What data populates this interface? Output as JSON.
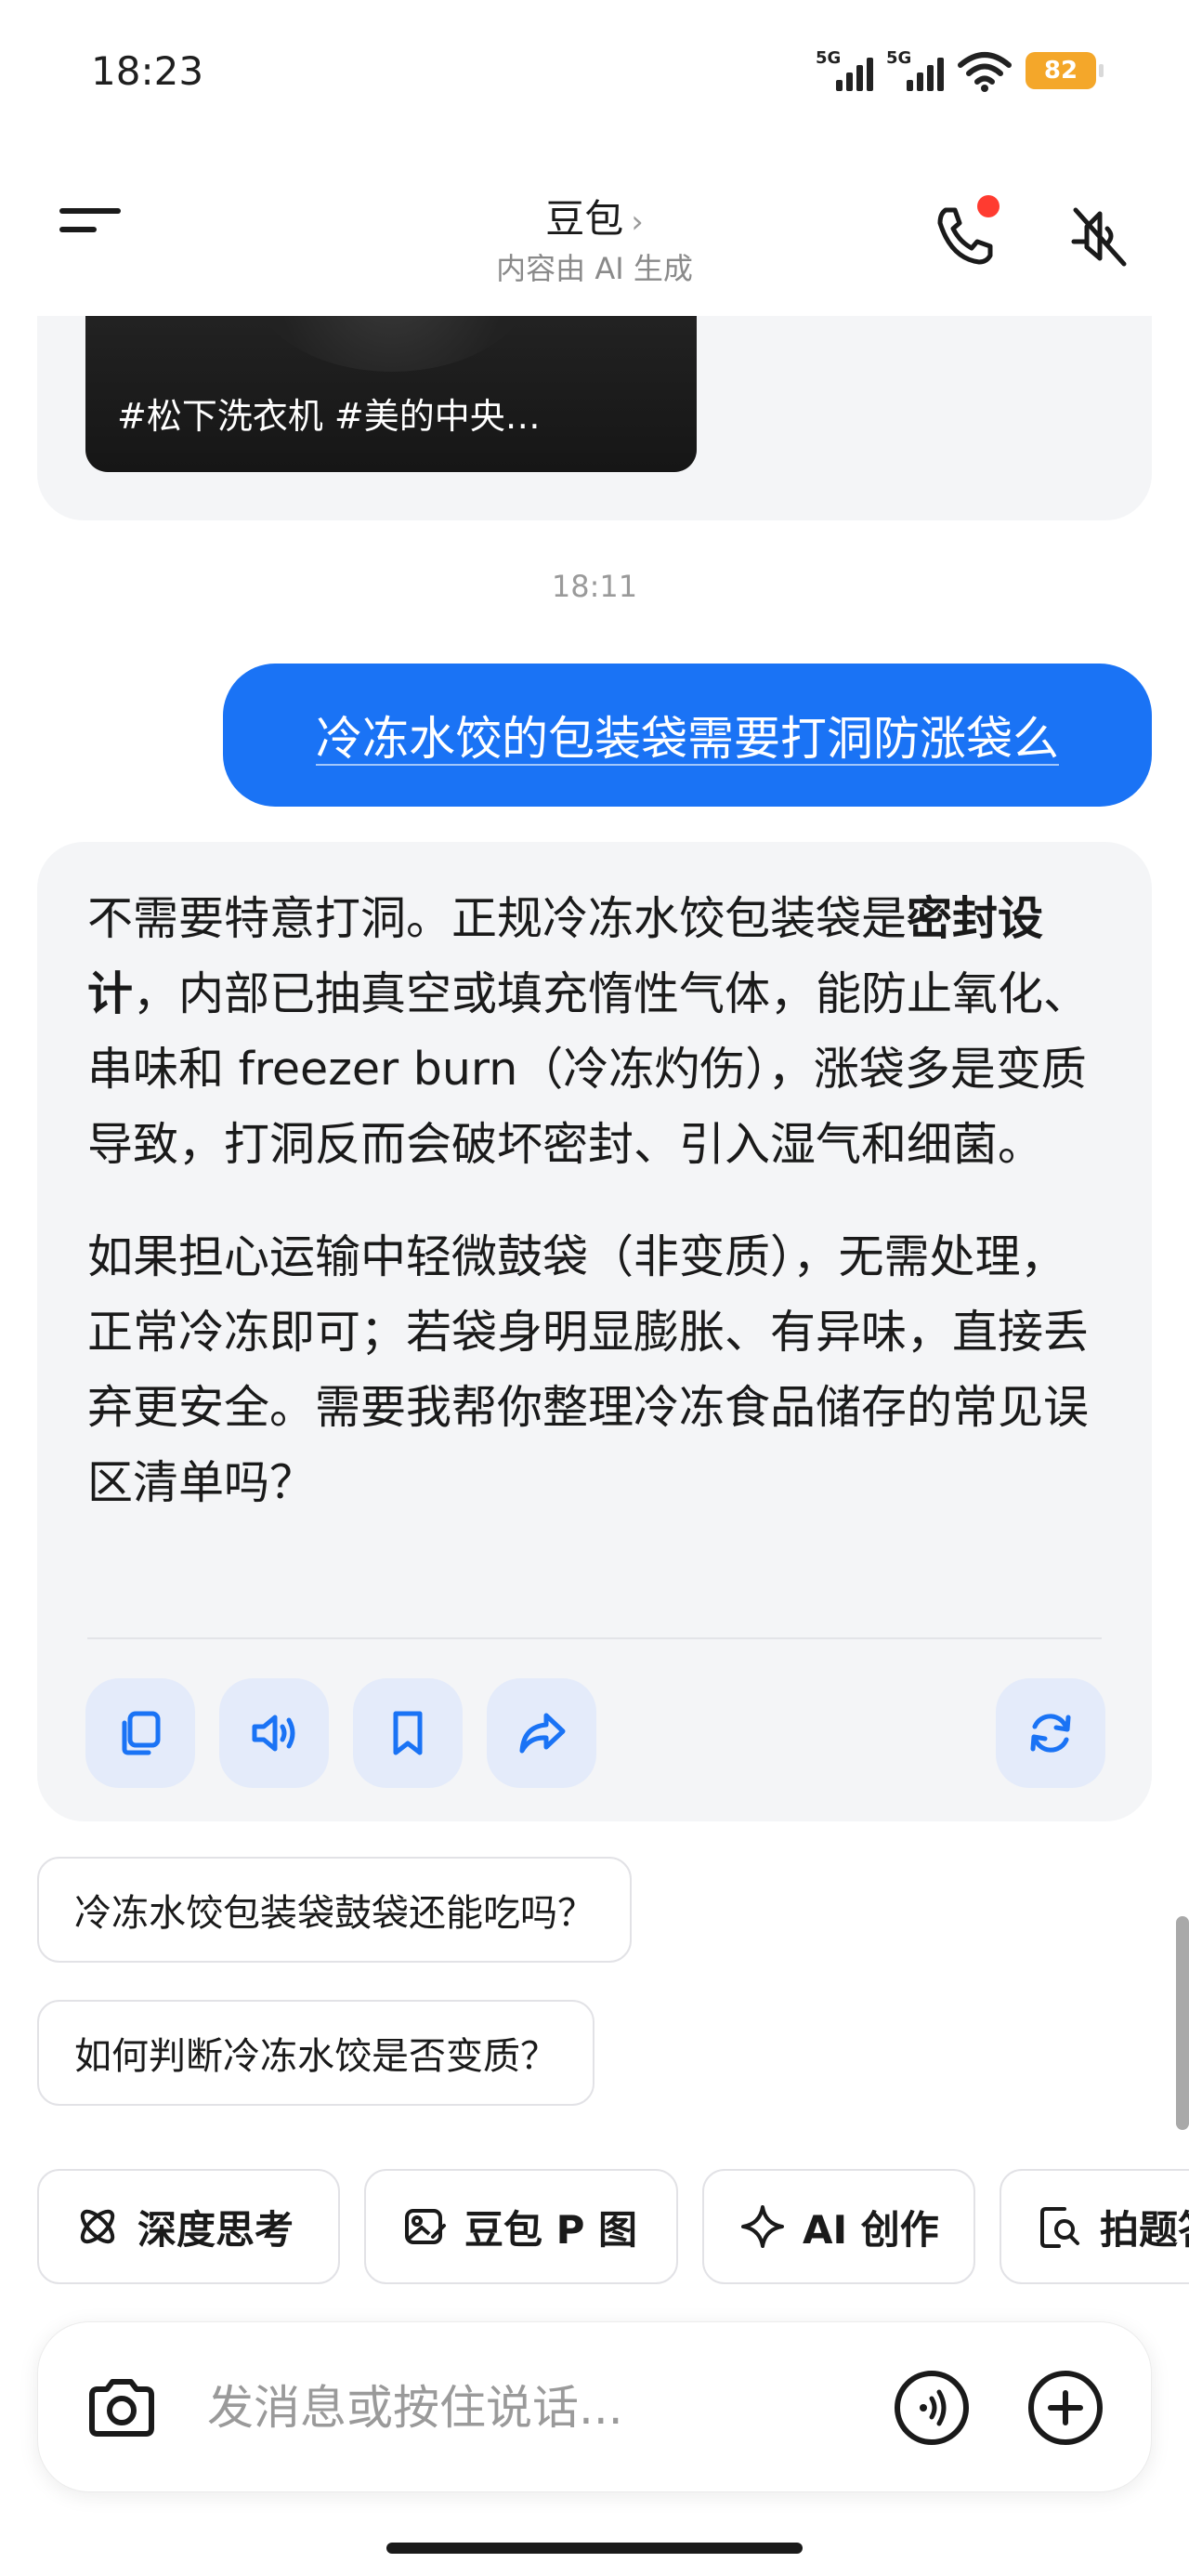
{
  "status_bar": {
    "time": "18:23",
    "signal1_label": "5G",
    "signal2_label": "5G",
    "battery": "82",
    "icons": [
      "signal-icon",
      "signal-icon",
      "wifi-icon",
      "battery-icon"
    ]
  },
  "header": {
    "title": "豆包",
    "chevron": "›",
    "subtitle": "内容由 AI 生成",
    "icons": [
      "menu-icon",
      "phone-icon",
      "mute-icon"
    ]
  },
  "previous_card": {
    "caption": "#松下洗衣机 #美的中央…"
  },
  "chat": {
    "timestamp": "18:11",
    "user_message": "冷冻水饺的包装袋需要打洞防涨袋么",
    "answer": {
      "p1_pre": "不需要特意打洞。正规冷冻水饺包装袋是",
      "p1_bold": "密封设计",
      "p1_post": "，内部已抽真空或填充惰性气体，能防止氧化、串味和 freezer burn（冷冻灼伤），涨袋多是变质导致，打洞反而会破坏密封、引入湿气和细菌。",
      "p2": "如果担心运输中轻微鼓袋（非变质），无需处理，正常冷冻即可；若袋身明显膨胀、有异味，直接丢弃更安全。需要我帮你整理冷冻食品储存的常见误区清单吗？"
    },
    "actions": [
      "copy-icon",
      "speaker-icon",
      "bookmark-icon",
      "share-icon",
      "regenerate-icon"
    ]
  },
  "suggestions": [
    "冷冻水饺包装袋鼓袋还能吃吗？",
    "如何判断冷冻水饺是否变质？"
  ],
  "tools": [
    {
      "label": "深度思考",
      "icon": "atom-icon"
    },
    {
      "label": "豆包 P 图",
      "icon": "image-edit-icon"
    },
    {
      "label": "AI 创作",
      "icon": "sparkle-icon"
    },
    {
      "label": "拍题答",
      "icon": "photo-search-icon"
    }
  ],
  "composer": {
    "placeholder": "发消息或按住说话...",
    "icons": [
      "camera-icon",
      "voice-icon",
      "plus-icon"
    ]
  },
  "colors": {
    "accent": "#1a73f5",
    "card_bg": "#f4f5f7",
    "action_bg": "#e4ebfa",
    "battery": "#f4a72a",
    "notification_dot": "#ff3b30"
  }
}
